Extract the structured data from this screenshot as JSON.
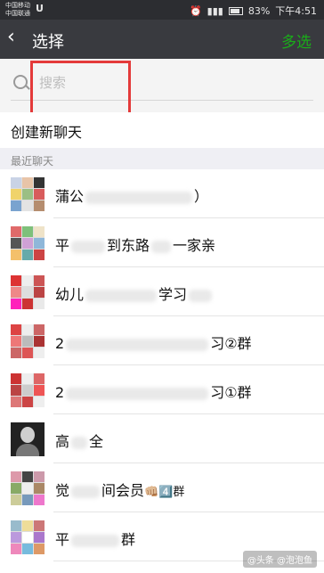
{
  "status_bar": {
    "carrier_1": "中国移动",
    "carrier_2": "中国联通",
    "carrier_logo": "U",
    "battery": "83%",
    "time": "下午4:51"
  },
  "nav": {
    "back_icon": "chevron-left-icon",
    "title": "选择",
    "multi_select": "多选"
  },
  "search": {
    "placeholder": "搜索"
  },
  "new_chat": "创建新聊天",
  "section_header": "最近聊天",
  "chats": [
    {
      "prefix": "蒲公",
      "suffix": "）"
    },
    {
      "prefix": "平",
      "mid": "到东路",
      "suffix": "一家亲"
    },
    {
      "prefix": "幼儿",
      "mid": "学习",
      "suffix": ""
    },
    {
      "prefix": "2",
      "mid": "",
      "suffix": "习②群"
    },
    {
      "prefix": "2",
      "mid": "",
      "suffix": "习①群"
    },
    {
      "prefix": "高",
      "mid": "",
      "suffix": "全"
    },
    {
      "prefix": "觉",
      "mid": "间会员",
      "suffix": "👊🏼4️⃣群"
    },
    {
      "prefix": "平",
      "mid": "",
      "suffix": "群"
    }
  ],
  "watermark": "@头条 @泡泡鱼"
}
